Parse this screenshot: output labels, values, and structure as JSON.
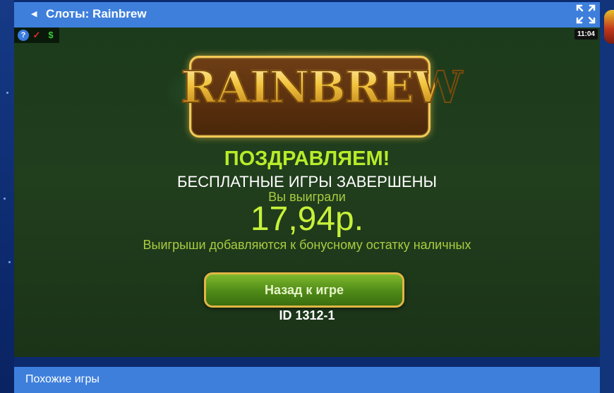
{
  "header": {
    "back_icon": "chevron-left-icon",
    "title": "Слоты: Rainbrew",
    "fullscreen_icon": "expand-icon"
  },
  "toolbar": {
    "help": "?",
    "check": "✓",
    "dollar": "$"
  },
  "clock": "11:04",
  "game": {
    "logo_text": "RAINBREW",
    "congrats": "ПОЗДРАВЛЯЕМ!",
    "subtitle": "БЕСПЛАТНЫЕ ИГРЫ ЗАВЕРШЕНЫ",
    "you_won": "Вы выиграли",
    "amount": "17,94р.",
    "note": "Выигрыши добавляются к бонусному остатку наличных",
    "back_button": "Назад к игре",
    "game_id": "ID 1312-1"
  },
  "similar": {
    "title": "Похожие игры"
  },
  "colors": {
    "header": "#3e7fdc",
    "accent_green": "#b7ec2a",
    "page_bg": "#0c2a6e"
  }
}
